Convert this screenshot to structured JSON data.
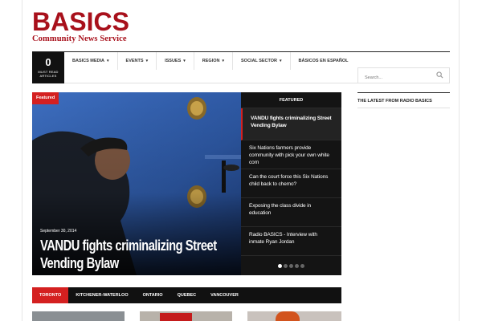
{
  "logo": {
    "main": "BASICS",
    "sub": "Community News Service",
    "color": "#a8101b"
  },
  "must_read": {
    "count": "0",
    "label_line1": "MUST READ",
    "label_line2": "ARTICLES"
  },
  "menu": {
    "items": [
      {
        "label": "BASICS MEDIA",
        "dropdown": true
      },
      {
        "label": "EVENTS",
        "dropdown": true
      },
      {
        "label": "ISSUES",
        "dropdown": true
      },
      {
        "label": "REGION",
        "dropdown": true
      },
      {
        "label": "SOCIAL SECTOR",
        "dropdown": true
      },
      {
        "label": "BÁSICOS EN ESPAÑOL",
        "dropdown": false
      }
    ]
  },
  "search": {
    "placeholder": "Search...",
    "icon": "search-icon"
  },
  "slider": {
    "badge": "Featured",
    "date": "September 30, 2014",
    "title": "VANDU fights criminalizing Street Vending Bylaw",
    "accent_color": "#d42020"
  },
  "featured_panel": {
    "heading": "FEATURED",
    "items": [
      {
        "title": "VANDU fights criminalizing Street Vending Bylaw",
        "active": true
      },
      {
        "title": "Six Nations farmers provide community with pick your own white corn",
        "active": false
      },
      {
        "title": "Can the court force this Six Nations child back to chemo?",
        "active": false
      },
      {
        "title": "Exposing the class divide in education",
        "active": false
      },
      {
        "title": "Radio BASICS - Interview with inmate Ryan Jordan",
        "active": false
      }
    ],
    "dots": 5,
    "active_dot": 1
  },
  "sidebar": {
    "radio_title": "THE LATEST FROM RADIO BASICS"
  },
  "tabs": {
    "items": [
      "TORONTO",
      "KITCHENER-WATERLOO",
      "ONTARIO",
      "QUEBEC",
      "VANCOUVER"
    ],
    "active": 0
  }
}
